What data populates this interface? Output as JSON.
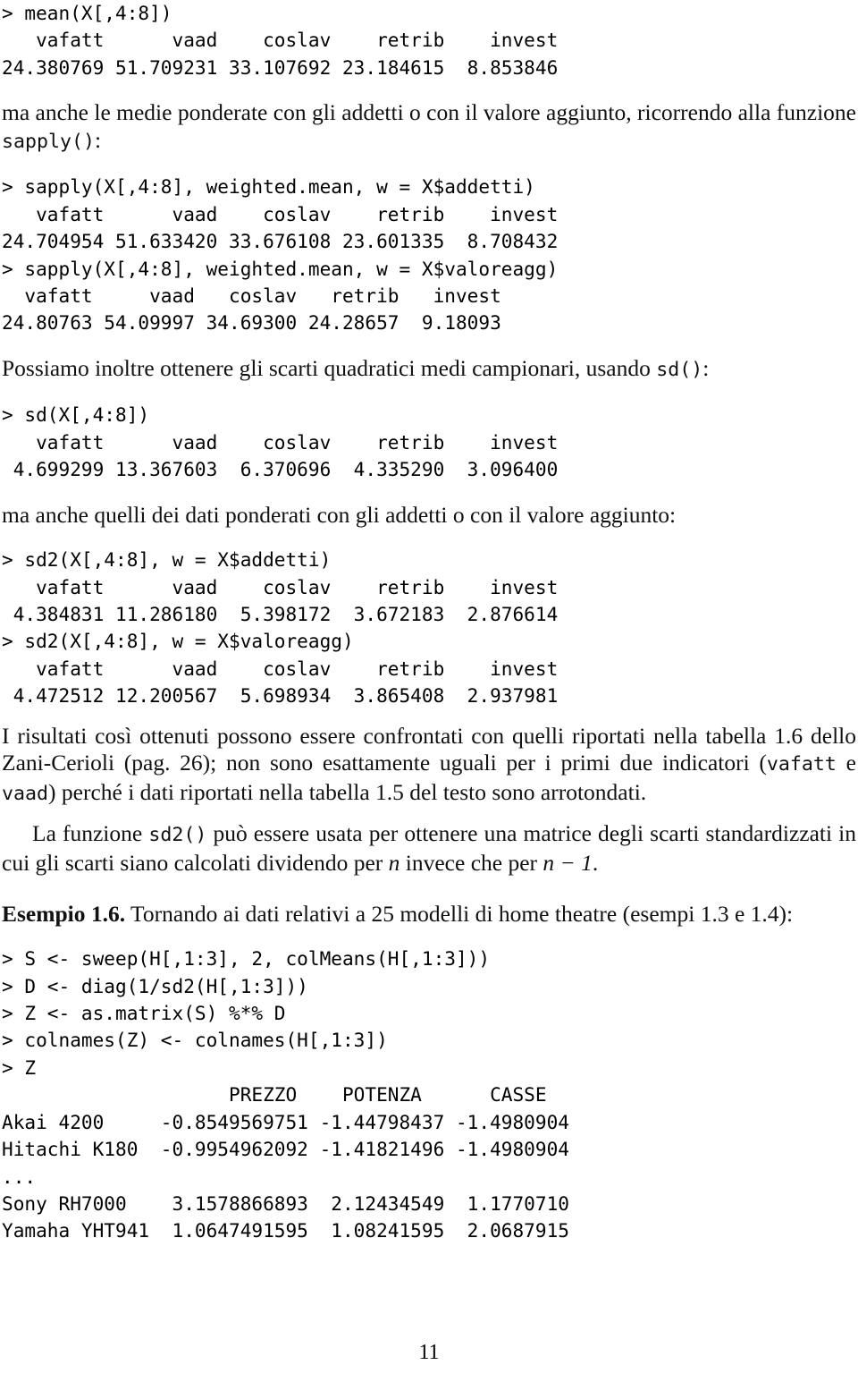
{
  "page": {
    "folio": "11"
  },
  "blocks": {
    "code1": "> mean(X[,4:8])\n   vafatt      vaad    coslav    retrib    invest \n24.380769 51.709231 33.107692 23.184615  8.853846 ",
    "para1_a": "ma anche le medie ponderate con gli addetti o con il valore aggiunto, ricorrendo alla funzione ",
    "para1_code": "sapply()",
    "para1_b": ":",
    "code2": "> sapply(X[,4:8], weighted.mean, w = X$addetti)\n   vafatt      vaad    coslav    retrib    invest \n24.704954 51.633420 33.676108 23.601335  8.708432 \n> sapply(X[,4:8], weighted.mean, w = X$valoreagg)\n  vafatt     vaad   coslav   retrib   invest \n24.80763 54.09997 34.69300 24.28657  9.18093 ",
    "para2_a": "Possiamo inoltre ottenere gli scarti quadratici medi campionari, usando ",
    "para2_code": "sd()",
    "para2_b": ":",
    "code3": "> sd(X[,4:8])\n   vafatt      vaad    coslav    retrib    invest \n 4.699299 13.367603  6.370696  4.335290  3.096400 ",
    "para3": "ma anche quelli dei dati ponderati con gli addetti o con il valore aggiunto:",
    "code4": "> sd2(X[,4:8], w = X$addetti)\n   vafatt      vaad    coslav    retrib    invest \n 4.384831 11.286180  5.398172  3.672183  2.876614 \n> sd2(X[,4:8], w = X$valoreagg)\n   vafatt      vaad    coslav    retrib    invest \n 4.472512 12.200567  5.698934  3.865408  2.937981 ",
    "para4_a": "I risultati così ottenuti possono essere confrontati con quelli riportati nella tabella 1.6 dello Zani-Cerioli (pag. 26); non sono esattamente uguali per i primi due indicatori (",
    "para4_code1": "vafatt",
    "para4_b": " e ",
    "para4_code2": "vaad",
    "para4_c": ") perché i dati riportati nella tabella 1.5 del testo sono arrotondati.",
    "para5_a": "La funzione ",
    "para5_code": "sd2()",
    "para5_b": " può essere usata per ottenere una matrice degli scarti standardizzati in cui gli scarti siano calcolati dividendo per ",
    "para5_math1": "n",
    "para5_c": " invece che per ",
    "para5_math2": "n − 1",
    "para5_d": ".",
    "para6_label": "Esempio 1.6.",
    "para6_text": " Tornando ai dati relativi a 25 modelli di home theatre (esempi 1.3 e 1.4):",
    "code5": "> S <- sweep(H[,1:3], 2, colMeans(H[,1:3]))\n> D <- diag(1/sd2(H[,1:3]))\n> Z <- as.matrix(S) %*% D\n> colnames(Z) <- colnames(H[,1:3])\n> Z\n                    PREZZO    POTENZA      CASSE\nAkai 4200     -0.8549569751 -1.44798437 -1.4980904\nHitachi K180  -0.9954962092 -1.41821496 -1.4980904\n...\nSony RH7000    3.1578866893  2.12434549  1.1770710\nYamaha YHT941  1.0647491595  1.08241595  2.0687915"
  }
}
